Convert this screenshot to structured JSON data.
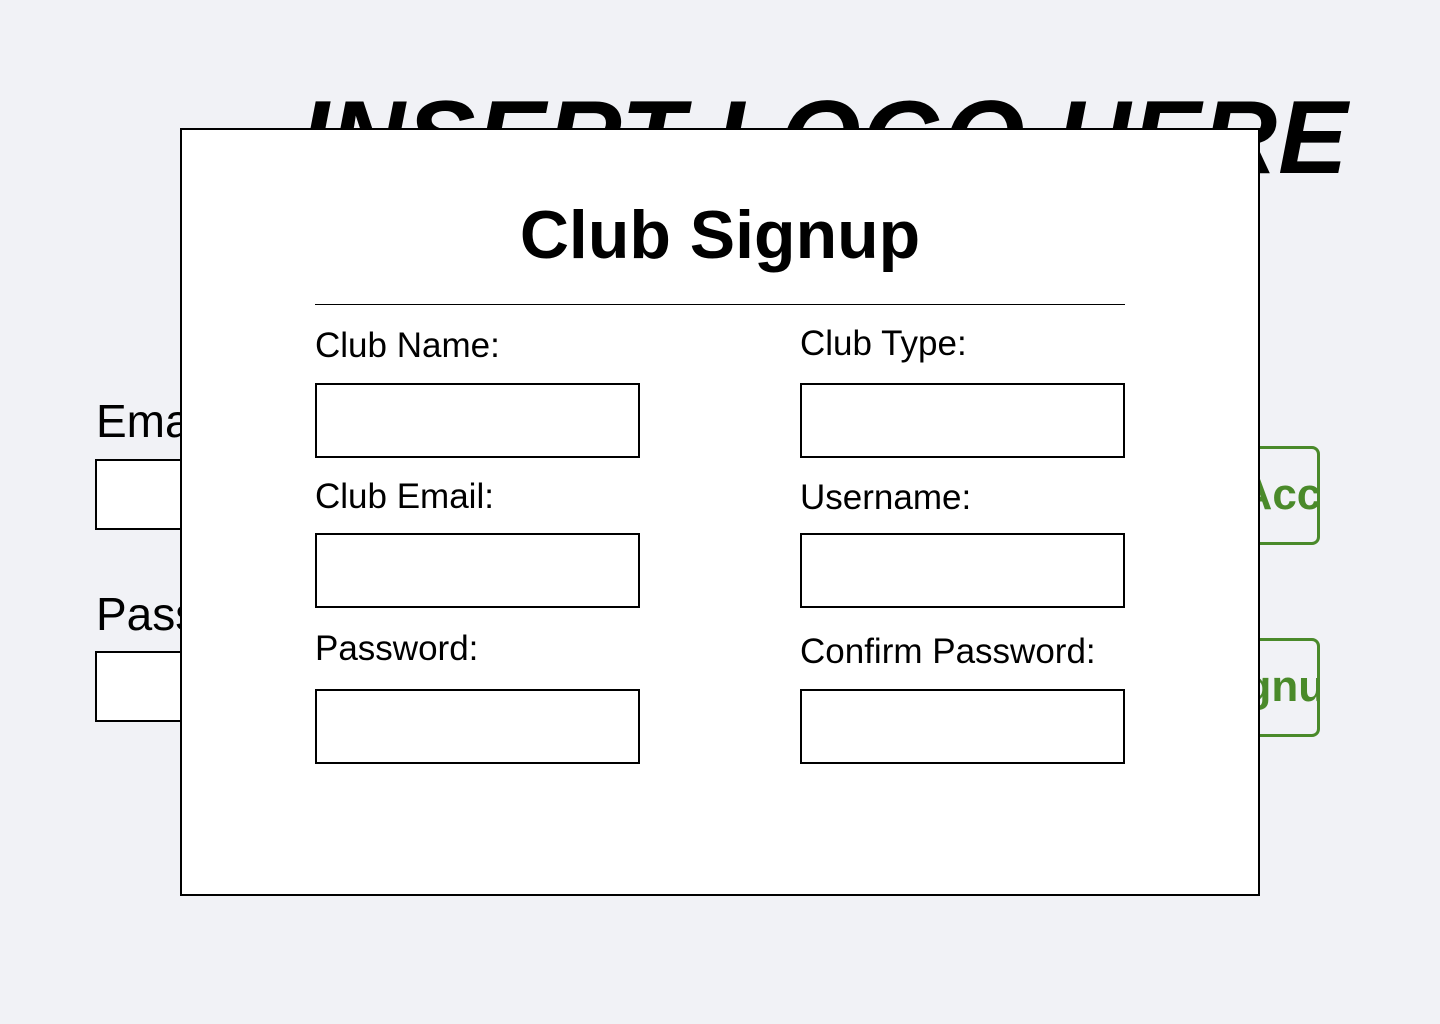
{
  "background": {
    "logo_text": "INSERT LOGO HERE",
    "email_label": "Email:",
    "password_label": "Password:",
    "primary_button_label": "Create Account",
    "secondary_button_label": "Club Signup",
    "accent_color": "#4a8a2a",
    "page_color": "#f1f2f6"
  },
  "modal": {
    "title": "Club Signup",
    "fields": {
      "club_name": {
        "label": "Club Name:",
        "value": ""
      },
      "club_type": {
        "label": "Club Type:",
        "value": ""
      },
      "club_email": {
        "label": "Club Email:",
        "value": ""
      },
      "username": {
        "label": "Username:",
        "value": ""
      },
      "password": {
        "label": "Password:",
        "value": ""
      },
      "confirm_password": {
        "label": "Confirm Password:",
        "value": ""
      }
    }
  }
}
